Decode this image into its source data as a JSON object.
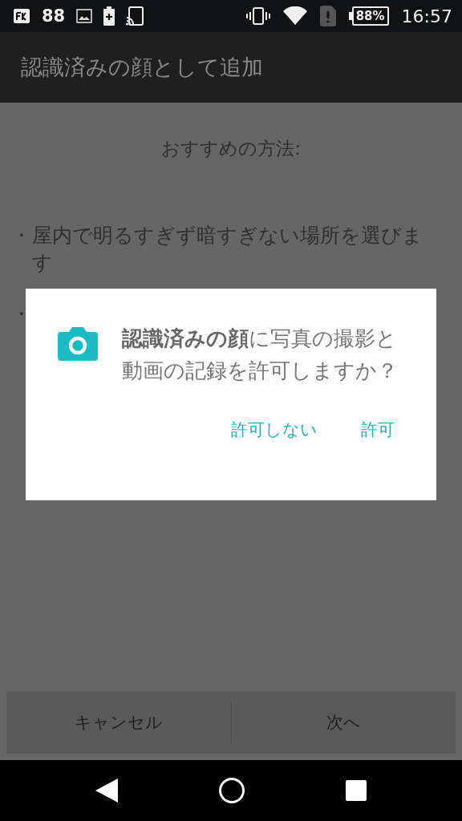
{
  "status_bar": {
    "notification_count": "88",
    "battery": "88%",
    "time": "16:57"
  },
  "app_bar": {
    "title": "認識済みの顔として追加"
  },
  "content": {
    "heading": "おすすめの方法:",
    "tips": [
      {
        "bullet": "・",
        "text": "屋内で明るすぎず暗すぎない場所を選びます"
      },
      {
        "bullet": "・"
      }
    ]
  },
  "buttons": [
    {
      "label": "キャンセル"
    },
    {
      "label": "次へ"
    }
  ],
  "dialog": {
    "message": "**認識済みの顔**に写真の撮影と動画の記録を許可しますか？",
    "actions": [
      {
        "label": "許可しない"
      },
      {
        "label": "許可"
      }
    ]
  }
}
